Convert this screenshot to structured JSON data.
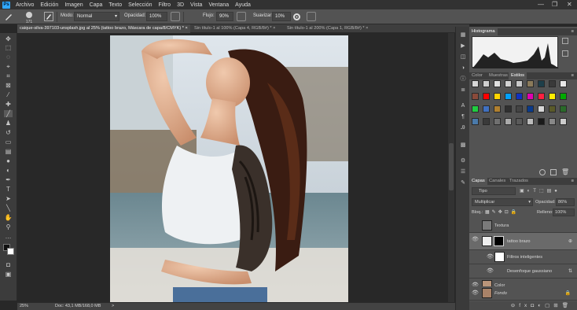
{
  "app": {
    "logo": "Ps"
  },
  "menu": [
    "Archivo",
    "Edición",
    "Imagen",
    "Capa",
    "Texto",
    "Selección",
    "Filtro",
    "3D",
    "Vista",
    "Ventana",
    "Ayuda"
  ],
  "window": {
    "minimize": "—",
    "restore": "❐",
    "close": "✕"
  },
  "options": {
    "brush_size": "171",
    "mode_label": "Modo:",
    "mode_value": "Normal",
    "opacity_label": "Opacidad:",
    "opacity_value": "100%",
    "flow_label": "Flujo:",
    "flow_value": "90%",
    "smooth_label": "Suavizar:",
    "smooth_value": "10%"
  },
  "tabs": [
    {
      "label": "caique-silva-397103-unsplash.jpg al 25% (tattoo brazo, Máscara de capa/8/CMYK) *",
      "close": "×"
    },
    {
      "label": "Sin título-1 al 100% (Capa 4, RGB/8#) *",
      "close": "×"
    },
    {
      "label": "Sin título-1 al 200% (Capa 1, RGB/8#) *",
      "close": "×"
    }
  ],
  "status": {
    "zoom": "25%",
    "doc": "Doc: 43,1 MB/168,0 MB",
    "arrow": ">"
  },
  "histogram": {
    "title": "Histograma",
    "menu": "≡"
  },
  "color_panel": {
    "tabs": [
      "Color",
      "Muestras",
      "Estilos"
    ],
    "active_tab": "Estilos",
    "styles": [
      "#d8d8d8",
      "#cfcfcf",
      "#e0e0e0",
      "#d2d2d2",
      "#c9c9c9",
      "#8a7a5a",
      "#1e3f4a",
      "#3a3a3a",
      "#e8e8e8",
      "#8a4a3a",
      "#ff0000",
      "#ffd400",
      "#00a0ff",
      "#1030c0",
      "#e000b0",
      "#ff2040",
      "#ffee00",
      "#00aa00",
      "#20cc40",
      "#4070c0",
      "#b08030",
      "#303030",
      "#444",
      "#0a3a8a",
      "#d8d8d8",
      "#5a5a2a",
      "#2a6a2a",
      "#4a7aaa",
      "#3a3a3a",
      "#707070",
      "#aaaaaa",
      "#5a5a5a",
      "#bcbcbc",
      "#1a1a1a",
      "#888",
      "#cccccc"
    ]
  },
  "layers_panel": {
    "tabs": [
      "Capas",
      "Canales",
      "Trazados"
    ],
    "active_tab": "Capas",
    "filter_kind": "Tipo",
    "blend_mode": "Multiplicar",
    "opacity_label": "Opacidad:",
    "opacity_value": "86%",
    "lock_label": "Bloq.:",
    "fill_label": "Relleno:",
    "fill_value": "100%",
    "layers": [
      {
        "name": "Textura",
        "visible": false,
        "type": "solid"
      },
      {
        "name": "tattoo brazo",
        "visible": true,
        "type": "masked",
        "selected": true
      },
      {
        "name": "Filtros inteligentes",
        "visible": true,
        "type": "smart-filter"
      },
      {
        "name": "Desenfoque gaussiano",
        "visible": true,
        "type": "filter"
      },
      {
        "name": "Color",
        "visible": true,
        "type": "photo"
      },
      {
        "name": "Fondo",
        "visible": true,
        "type": "photo",
        "locked": true
      }
    ]
  }
}
